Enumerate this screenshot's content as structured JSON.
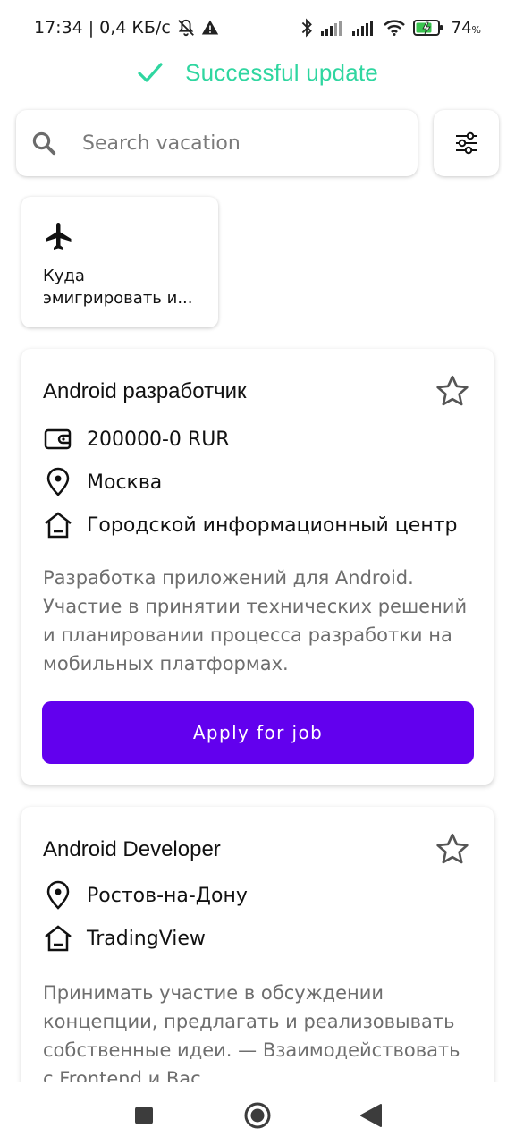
{
  "status_bar": {
    "time": "17:34",
    "network_speed": "0,4 КБ/с",
    "battery": "74",
    "battery_suffix": "%",
    "icons": [
      "mute-icon",
      "warning-icon",
      "bluetooth-icon",
      "signal-icon",
      "signal-icon",
      "wifi-icon",
      "battery-icon"
    ]
  },
  "toast": {
    "icon": "checkmark-icon",
    "message": "Successful update",
    "color": "#2fd6a0"
  },
  "search": {
    "placeholder": "Search vacation",
    "value": "",
    "icon": "search-icon"
  },
  "filter": {
    "icon": "sliders-icon"
  },
  "categories": [
    {
      "icon": "airplane-icon",
      "label": "Куда эмигрировать и..."
    }
  ],
  "jobs": [
    {
      "title": "Android разработчик",
      "salary": "200000-0 RUR",
      "city": "Москва",
      "company": "Городской информационный центр",
      "description": "Разработка приложений для Android. Участие в принятии технических решений и планировании процесса разработки на мобильных платформах.",
      "apply_label": "Apply for job"
    },
    {
      "title": "Android Developer",
      "city": "Ростов-на-Дону",
      "company": "TradingView",
      "description": "Принимать участие в обсуждении концепции, предлагать и реализовывать собственные идеи. — Взаимодействовать с Frontend и Bac..."
    }
  ],
  "colors": {
    "accent": "#6200ee",
    "success": "#2fd6a0"
  },
  "nav": {
    "icons": [
      "recents-icon",
      "home-icon",
      "back-icon"
    ]
  }
}
